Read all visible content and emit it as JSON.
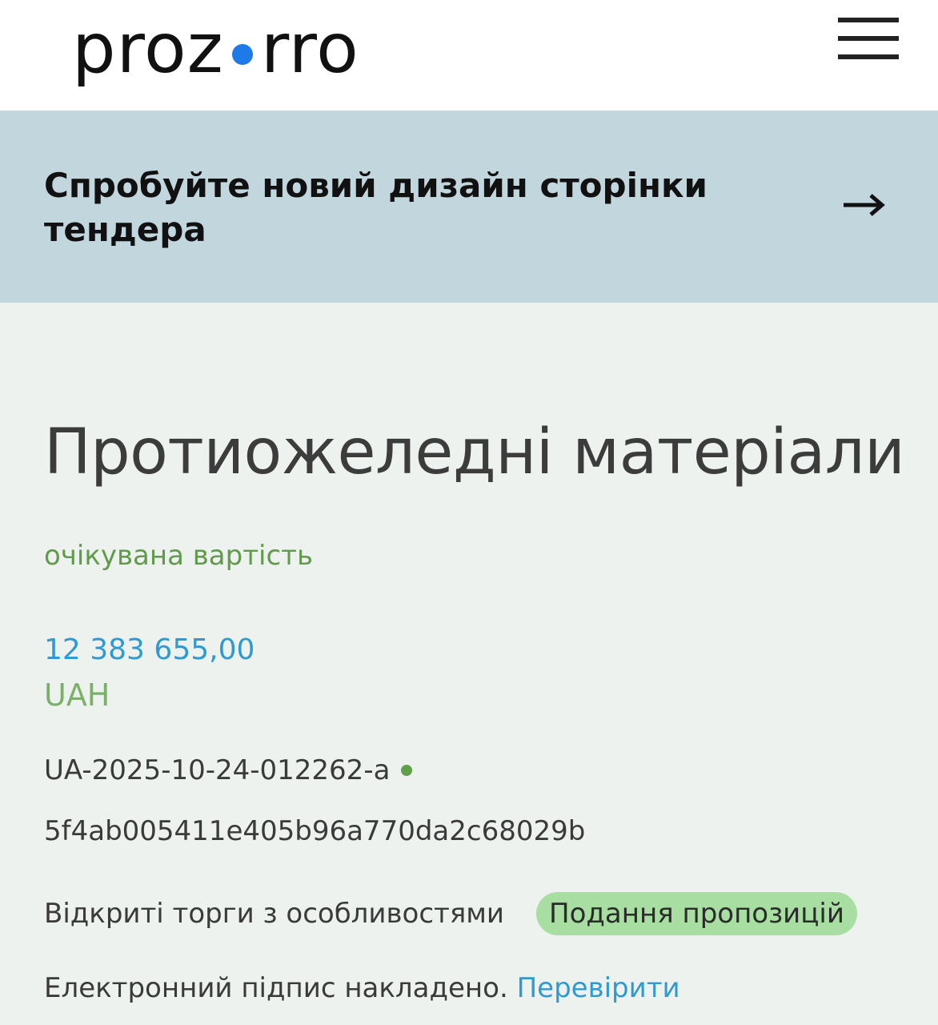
{
  "header": {
    "logo_left": "proz",
    "logo_right": "rro",
    "brand_color": "#1d7ae6"
  },
  "promo": {
    "text": "Спробуйте новий дизайн сторінки тендера",
    "arrow_icon": "arrow-right-icon",
    "background": "#c2d6de"
  },
  "tender": {
    "title": "Протиожеледні матеріали",
    "expected_label": "очікувана вартість",
    "amount": "12 383 655,00",
    "currency": "UAH",
    "id": "UA-2025-10-24-012262-a",
    "hash": "5f4ab005411e405b96a770da2c68029b",
    "procedure_type": "Відкриті торги з особливостями",
    "status": "Подання пропозицій",
    "signature_text": "Електронний підпис накладено.",
    "verify_link": "Перевірити"
  },
  "colors": {
    "accent_blue": "#2f9ad2",
    "label_green": "#5f9b4a",
    "status_green": "#a9dea3",
    "page_background": "#eef2ef"
  }
}
